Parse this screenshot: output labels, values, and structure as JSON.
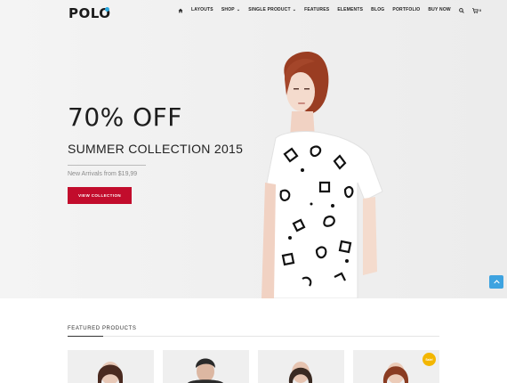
{
  "brand": {
    "logo_text": "POLO",
    "accent_color": "#2aa9e0"
  },
  "nav": {
    "home_icon": "home-icon",
    "items": [
      {
        "label": "LAYOUTS",
        "has_dropdown": false
      },
      {
        "label": "SHOP",
        "has_dropdown": true
      },
      {
        "label": "SINGLE PRODUCT",
        "has_dropdown": true
      },
      {
        "label": "FEATURES",
        "has_dropdown": false
      },
      {
        "label": "ELEMENTS",
        "has_dropdown": false
      },
      {
        "label": "BLOG",
        "has_dropdown": false
      },
      {
        "label": "PORTFOLIO",
        "has_dropdown": false
      },
      {
        "label": "BUY NOW",
        "has_dropdown": false
      }
    ],
    "search_icon": "search-icon",
    "cart_icon": "cart-icon",
    "cart_count": "0"
  },
  "hero": {
    "headline": "70% OFF",
    "subheadline": "SUMMER COLLECTION 2015",
    "arrivals_text": "New Arrivals from $19,99",
    "cta_label": "VIEW COLLECTION",
    "cta_color": "#c20c2c"
  },
  "scroll_top": {
    "icon": "chevron-up-icon",
    "color": "#3ea3e0"
  },
  "featured": {
    "title": "FEATURED PRODUCTS",
    "products": [
      {
        "image": "woman-portrait-image"
      },
      {
        "image": "man-portrait-image"
      },
      {
        "image": "woman-portrait-image"
      },
      {
        "image": "woman-portrait-image",
        "badge": "Sale!"
      }
    ]
  }
}
